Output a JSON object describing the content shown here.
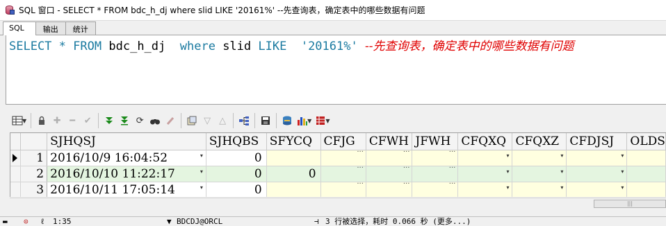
{
  "window": {
    "title": "SQL 窗口 - SELECT * FROM bdc_h_dj where slid LIKE '20161%' --先查询表，确定表中的哪些数据有问题"
  },
  "tabs": [
    {
      "label": "SQL",
      "active": true
    },
    {
      "label": "输出",
      "active": false
    },
    {
      "label": "统计",
      "active": false
    }
  ],
  "editor": {
    "kw_select": "SELECT",
    "star": "*",
    "kw_from": "FROM",
    "table": "bdc_h_dj",
    "kw_where": "where",
    "column": "slid",
    "kw_like": "LIKE",
    "literal": "'20161%'",
    "comment": "--先查询表，确定表中的哪些数据有问题"
  },
  "grid": {
    "columns": [
      "SJHQSJ",
      "SJHQBS",
      "SFYCQ",
      "CFJG",
      "CFWH",
      "JFWH",
      "CFQXQ",
      "CFQXZ",
      "CFDJSJ",
      "OLDS"
    ],
    "rows": [
      {
        "num": "1",
        "SJHQSJ": "2016/10/9 16:04:52",
        "SJHQBS": "0",
        "SFYCQ": ""
      },
      {
        "num": "2",
        "SJHQSJ": "2016/10/10 11:22:17",
        "SJHQBS": "0",
        "SFYCQ": "0"
      },
      {
        "num": "3",
        "SJHQSJ": "2016/10/11 17:05:14",
        "SJHQBS": "0",
        "SFYCQ": ""
      }
    ],
    "ellipsis": "···"
  },
  "statusbar": {
    "position": "1:35",
    "connection": "BDCDJ@ORCL",
    "message": "3 行被选择，耗时 0.066 秒 (更多...)"
  },
  "colors": {
    "keyword": "#1a7aa0",
    "comment": "#e00000",
    "selected_row": "#e4f5e0",
    "highlight_cell": "#ffffe0"
  }
}
